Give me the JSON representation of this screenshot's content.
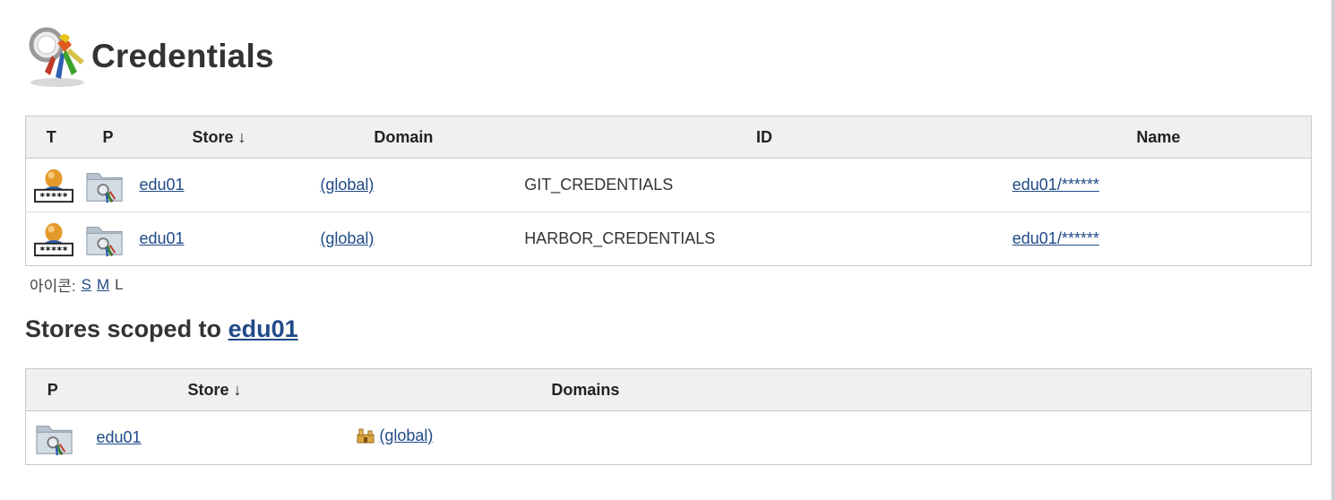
{
  "page": {
    "title": "Credentials"
  },
  "credentials_table": {
    "columns": {
      "t": "T",
      "p": "P",
      "store": "Store ↓",
      "domain": "Domain",
      "id": "ID",
      "name": "Name"
    },
    "rows": [
      {
        "store": "edu01",
        "domain": "(global)",
        "id": "GIT_CREDENTIALS",
        "name": "edu01/******",
        "type_icon": "user-password-icon",
        "provider_icon": "folder-credentials-icon"
      },
      {
        "store": "edu01",
        "domain": "(global)",
        "id": "HARBOR_CREDENTIALS",
        "name": "edu01/******",
        "type_icon": "user-password-icon",
        "provider_icon": "folder-credentials-icon"
      }
    ]
  },
  "icon_size": {
    "label": "아이콘:",
    "small": "S",
    "medium": "M",
    "large": "L"
  },
  "stores_section": {
    "title_prefix": "Stores scoped to",
    "title_link": "edu01"
  },
  "stores_table": {
    "columns": {
      "p": "P",
      "store": "Store ↓",
      "domains": "Domains"
    },
    "rows": [
      {
        "store": "edu01",
        "domain": "(global)",
        "provider_icon": "folder-credentials-icon",
        "domain_icon": "domain-icon"
      }
    ]
  },
  "colors": {
    "link": "#204a87",
    "header_bg": "#f0f0f0",
    "border": "#c8c8c8"
  }
}
